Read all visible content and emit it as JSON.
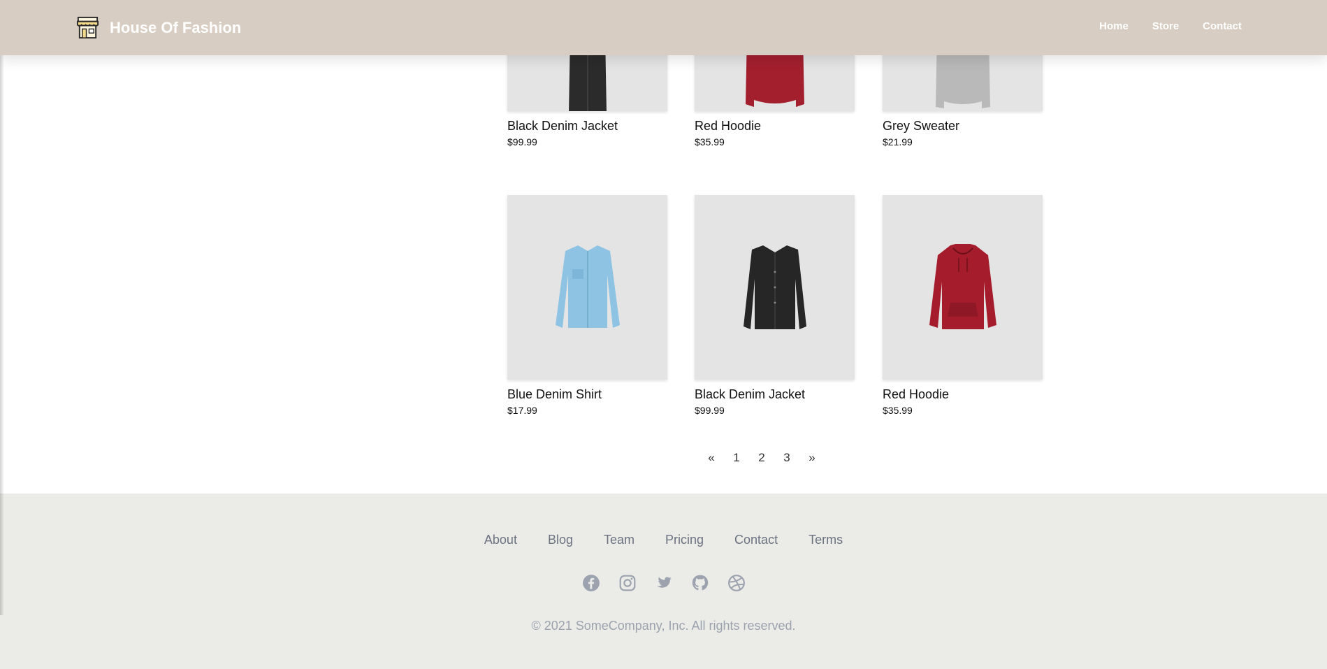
{
  "header": {
    "brand": "House Of Fashion",
    "brand_icon": "storefront-icon",
    "nav": [
      "Home",
      "Store",
      "Contact"
    ]
  },
  "products_row1": [
    {
      "name": "Black Denim Jacket",
      "price": "$99.99",
      "color": "#2b2b2b"
    },
    {
      "name": "Red Hoodie",
      "price": "$35.99",
      "color": "#a31f2e"
    },
    {
      "name": "Grey Sweater",
      "price": "$21.99",
      "color": "#b9b9b9"
    }
  ],
  "products_row2": [
    {
      "name": "Blue Denim Shirt",
      "price": "$17.99",
      "color": "#8ec3e3"
    },
    {
      "name": "Black Denim Jacket",
      "price": "$99.99",
      "color": "#262626"
    },
    {
      "name": "Red Hoodie",
      "price": "$35.99",
      "color": "#a51d2d"
    }
  ],
  "pagination": [
    "«",
    "1",
    "2",
    "3",
    "»"
  ],
  "footer": {
    "links": [
      "About",
      "Blog",
      "Team",
      "Pricing",
      "Contact",
      "Terms"
    ],
    "socials": [
      "facebook-icon",
      "instagram-icon",
      "twitter-icon",
      "github-icon",
      "dribbble-icon"
    ],
    "copyright": "© 2021 SomeCompany, Inc. All rights reserved."
  },
  "colors": {
    "header_bg": "#d8cdc2",
    "footer_bg": "#ebebe7",
    "thumb_bg": "#e4e4e4",
    "footer_text": "#6b7280"
  }
}
